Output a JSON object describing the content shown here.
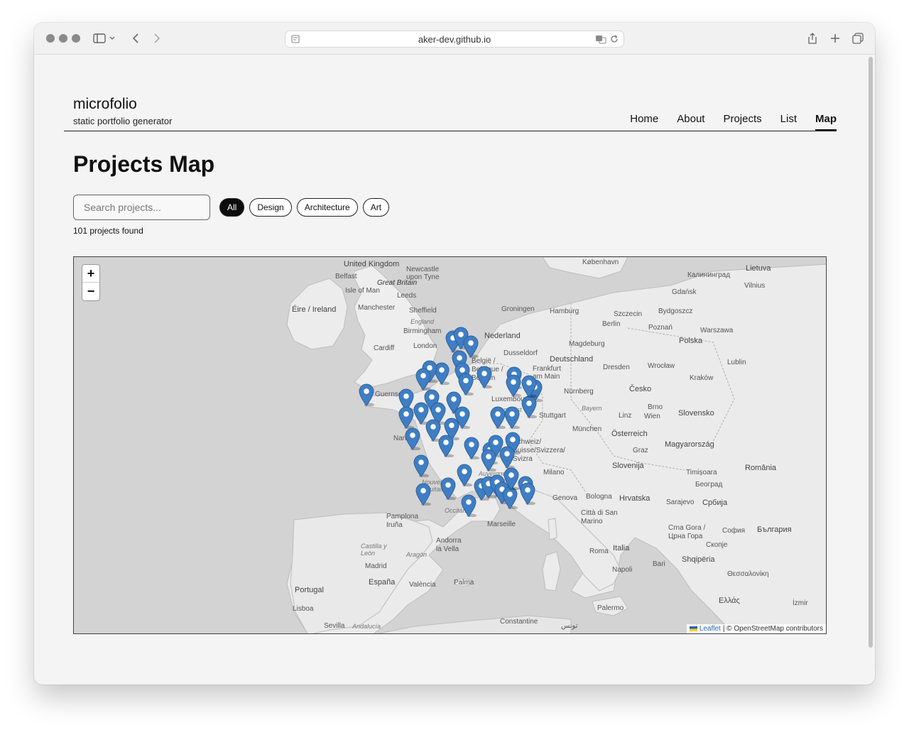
{
  "browser": {
    "url": "aker-dev.github.io"
  },
  "site": {
    "title": "microfolio",
    "subtitle": "static portfolio generator"
  },
  "nav": {
    "items": [
      "Home",
      "About",
      "Projects",
      "List",
      "Map"
    ],
    "active": "Map"
  },
  "page": {
    "title": "Projects Map",
    "search_placeholder": "Search projects...",
    "filters": [
      "All",
      "Design",
      "Architecture",
      "Art"
    ],
    "active_filter": "All",
    "result_count": "101 projects found"
  },
  "map": {
    "zoom_in": "+",
    "zoom_out": "−",
    "attribution_link": "Leaflet",
    "attribution_text": "| © OpenStreetMap contributors",
    "labels": {
      "united_kingdom": "United Kingdom",
      "newcastle": "Newcastle upon Tyne",
      "kobenhavn": "København",
      "kaliningrad": "Калининград",
      "lietuva": "Lietuva",
      "belfast": "Belfast",
      "great_britain": "Great Britain",
      "isle_of_man": "Isle of Man",
      "leeds": "Leeds",
      "eire": "Éire / Ireland",
      "manchester": "Manchester",
      "sheffield": "Sheffield",
      "groningen": "Groningen",
      "hamburg": "Hamburg",
      "szczecin": "Szczecin",
      "bydgoszcz": "Bydgoszcz",
      "gdansk": "Gdańsk",
      "vilnius": "Vilnius",
      "england": "England",
      "birmingham": "Birmingham",
      "berlin": "Berlin",
      "poznan": "Poznań",
      "warszawa": "Warszawa",
      "polska": "Polska",
      "nederland": "Nederland",
      "cardiff": "Cardiff",
      "london": "London",
      "magdeburg": "Magdeburg",
      "dusseldorf": "Dusseldorf",
      "deutschland": "Deutschland",
      "dresden": "Dresden",
      "wroclaw": "Wrocław",
      "lublin": "Lublin",
      "belgie": "België / Belgique / Belgien",
      "frankfurt": "Frankfurt am Main",
      "krakow": "Kraków",
      "guernsey": "Guernsey",
      "nurnberg": "Nürnberg",
      "cesko": "Česko",
      "luxembourg": "Luxembourg",
      "stuttgart": "Stuttgart",
      "grand_est": "Grand Est",
      "bayern": "Bayern",
      "brno": "Brno",
      "linz": "Linz",
      "wien": "Wien",
      "slovensko": "Slovensko",
      "munchen": "München",
      "osterreich": "Österreich",
      "schweiz": "Schweiz/ Suisse/Svizzera/ Svizra",
      "graz": "Graz",
      "magyarorszag": "Magyarország",
      "slovenija": "Slovenija",
      "milano": "Milano",
      "timisoara": "Timișoara",
      "romania": "România",
      "beograd": "Београд",
      "genova": "Genova",
      "bologna": "Bologna",
      "hrvatska": "Hrvatska",
      "srbija": "Србија",
      "sarajevo": "Sarajevo",
      "san_marino": "Città di San Marino",
      "nantes": "Nantes",
      "nouvelle_aquitaine": "Nouvelle-Aquitaine",
      "auvergne": "Auvergne-Rhône-Alpes",
      "occitanie": "Occitanie",
      "pamplona": "Pamplona Iruña",
      "andorra": "Andorra la Vella",
      "marseille": "Marseille",
      "crna_gora": "Crna Gora / Црна Гора",
      "sofia": "София",
      "balgaria": "България",
      "skopje": "Скопје",
      "roma": "Roma",
      "italia": "Italia",
      "bari": "Bari",
      "shqiperia": "Shqipëria",
      "castilla": "Castilla y León",
      "aragon": "Aragón",
      "madrid": "Madrid",
      "espana": "España",
      "valencia": "València",
      "palma": "Palma",
      "napoli": "Napoli",
      "thessaloniki": "Θεσσαλονίκη",
      "portugal": "Portugal",
      "lisboa": "Lisboa",
      "palermo": "Palermo",
      "ellas": "Ελλάς",
      "izmir": "İzmir",
      "sevilla": "Sevilla",
      "andalucia": "Andalucía",
      "constantine": "Constantine",
      "tunis": "تونس"
    }
  }
}
